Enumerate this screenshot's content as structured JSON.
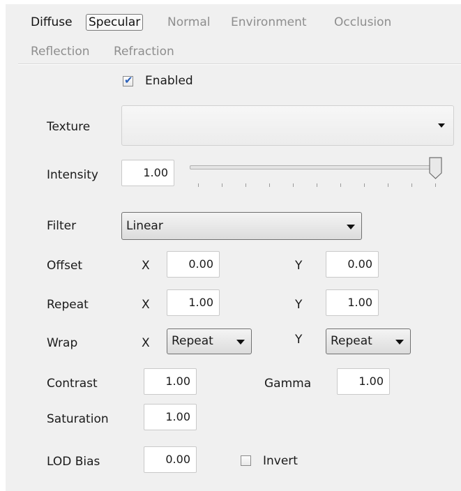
{
  "tabs": [
    {
      "label": "Diffuse",
      "state": "active"
    },
    {
      "label": "Specular",
      "state": "selected"
    },
    {
      "label": "Normal",
      "state": "inactive"
    },
    {
      "label": "Environment",
      "state": "inactive"
    },
    {
      "label": "Occlusion",
      "state": "inactive"
    },
    {
      "label": "Reflection",
      "state": "inactive"
    },
    {
      "label": "Refraction",
      "state": "inactive"
    }
  ],
  "enabled": {
    "label": "Enabled",
    "checked": true
  },
  "texture": {
    "label": "Texture",
    "value": ""
  },
  "intensity": {
    "label": "Intensity",
    "value": "1.00",
    "slider_fraction": 1.0
  },
  "filter": {
    "label": "Filter",
    "value": "Linear"
  },
  "offset": {
    "label": "Offset",
    "x_label": "X",
    "x": "0.00",
    "y_label": "Y",
    "y": "0.00"
  },
  "repeat": {
    "label": "Repeat",
    "x_label": "X",
    "x": "1.00",
    "y_label": "Y",
    "y": "1.00"
  },
  "wrap": {
    "label": "Wrap",
    "x_label": "X",
    "x": "Repeat",
    "y_label": "Y",
    "y": "Repeat"
  },
  "contrast": {
    "label": "Contrast",
    "value": "1.00"
  },
  "gamma": {
    "label": "Gamma",
    "value": "1.00"
  },
  "saturation": {
    "label": "Saturation",
    "value": "1.00"
  },
  "lod_bias": {
    "label": "LOD Bias",
    "value": "0.00"
  },
  "invert": {
    "label": "Invert",
    "checked": false
  },
  "colors": {
    "panel_bg": "#f0f0f0",
    "checkmark": "#2a5fb8",
    "inactive_tab": "#8e8e8e"
  }
}
